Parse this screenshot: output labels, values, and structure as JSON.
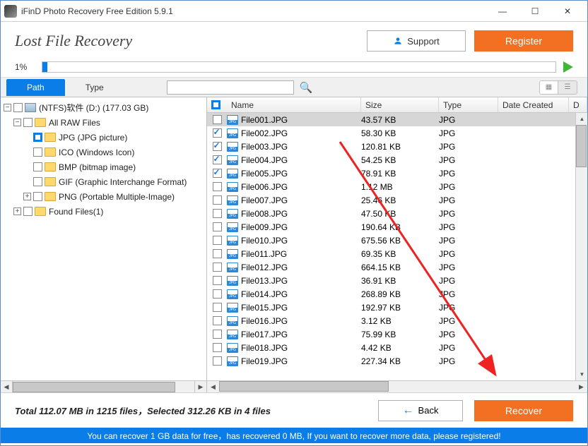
{
  "window": {
    "title": "iFinD Photo Recovery Free Edition 5.9.1"
  },
  "header": {
    "page_title": "Lost File Recovery",
    "support": "Support",
    "register": "Register"
  },
  "progress": {
    "percent_label": "1%",
    "percent_value": 1
  },
  "tabs": {
    "path": "Path",
    "type": "Type"
  },
  "search": {
    "placeholder": ""
  },
  "tree": {
    "drive": "(NTFS)软件 (D:) (177.03 GB)",
    "raw": "All RAW Files",
    "jpg": "JPG (JPG picture)",
    "ico": "ICO (Windows Icon)",
    "bmp": "BMP (bitmap image)",
    "gif": "GIF (Graphic Interchange Format)",
    "png": "PNG (Portable Multiple-Image)",
    "found": "Found Files(1)"
  },
  "columns": {
    "name": "Name",
    "size": "Size",
    "type": "Type",
    "date": "Date Created",
    "d": "D"
  },
  "files": [
    {
      "name": "File001.JPG",
      "size": "43.57 KB",
      "type": "JPG",
      "checked": false,
      "selected": true
    },
    {
      "name": "File002.JPG",
      "size": "58.30 KB",
      "type": "JPG",
      "checked": true
    },
    {
      "name": "File003.JPG",
      "size": "120.81 KB",
      "type": "JPG",
      "checked": true
    },
    {
      "name": "File004.JPG",
      "size": "54.25 KB",
      "type": "JPG",
      "checked": true
    },
    {
      "name": "File005.JPG",
      "size": "78.91 KB",
      "type": "JPG",
      "checked": true
    },
    {
      "name": "File006.JPG",
      "size": "1.12 MB",
      "type": "JPG",
      "checked": false
    },
    {
      "name": "File007.JPG",
      "size": "25.46 KB",
      "type": "JPG",
      "checked": false
    },
    {
      "name": "File008.JPG",
      "size": "47.50 KB",
      "type": "JPG",
      "checked": false
    },
    {
      "name": "File009.JPG",
      "size": "190.64 KB",
      "type": "JPG",
      "checked": false
    },
    {
      "name": "File010.JPG",
      "size": "675.56 KB",
      "type": "JPG",
      "checked": false
    },
    {
      "name": "File011.JPG",
      "size": "69.35 KB",
      "type": "JPG",
      "checked": false
    },
    {
      "name": "File012.JPG",
      "size": "664.15 KB",
      "type": "JPG",
      "checked": false
    },
    {
      "name": "File013.JPG",
      "size": "36.91 KB",
      "type": "JPG",
      "checked": false
    },
    {
      "name": "File014.JPG",
      "size": "268.89 KB",
      "type": "JPG",
      "checked": false
    },
    {
      "name": "File015.JPG",
      "size": "192.97 KB",
      "type": "JPG",
      "checked": false
    },
    {
      "name": "File016.JPG",
      "size": "3.12 KB",
      "type": "JPG",
      "checked": false
    },
    {
      "name": "File017.JPG",
      "size": "75.99 KB",
      "type": "JPG",
      "checked": false
    },
    {
      "name": "File018.JPG",
      "size": "4.42 KB",
      "type": "JPG",
      "checked": false
    },
    {
      "name": "File019.JPG",
      "size": "227.34 KB",
      "type": "JPG",
      "checked": false
    }
  ],
  "footer": {
    "stats": "Total 112.07 MB in 1215 files，Selected 312.26 KB in 4 files",
    "back": "Back",
    "recover": "Recover"
  },
  "banner": "You can recover 1 GB data for free，has recovered 0 MB, If you want to recover more data, please registered!"
}
